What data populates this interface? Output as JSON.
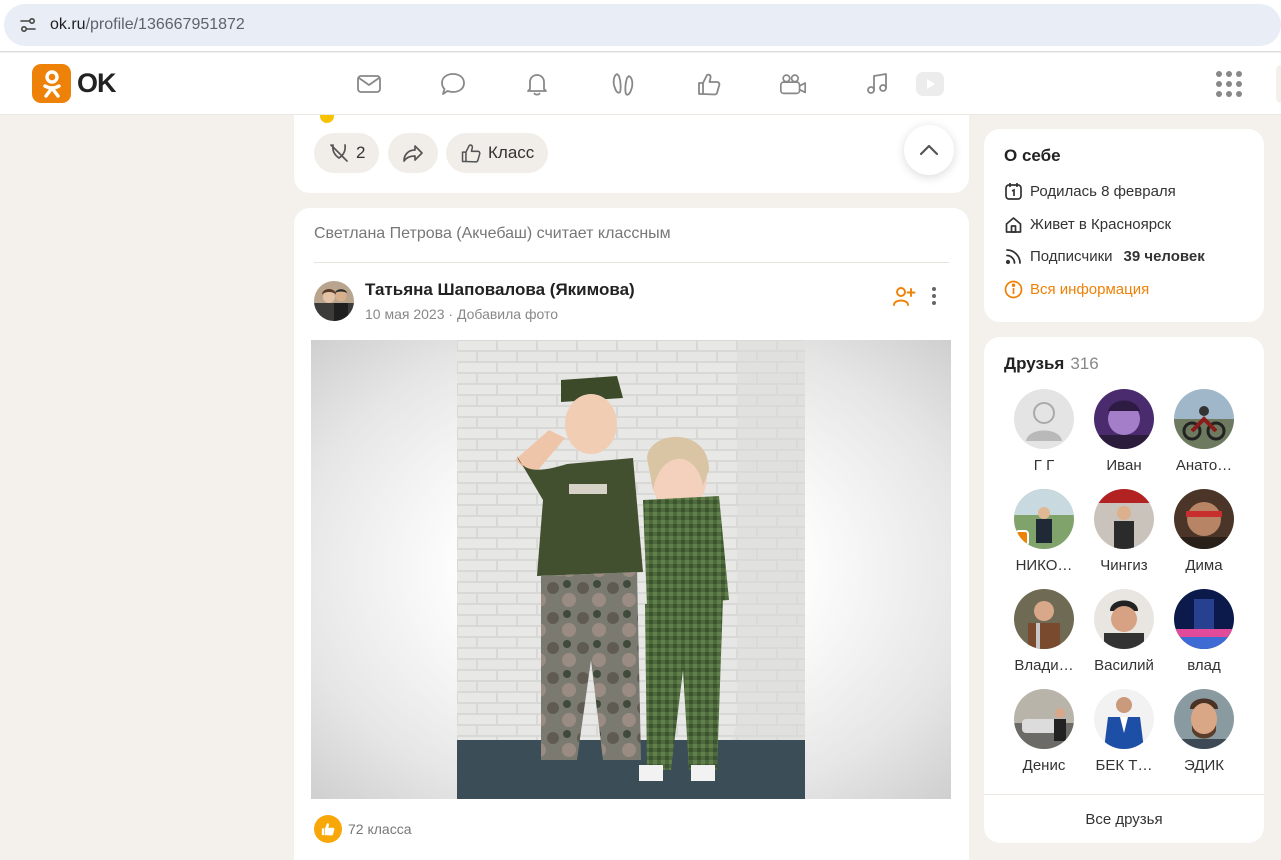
{
  "browser": {
    "url_host": "ok.ru",
    "url_path": "/profile/136667951872"
  },
  "header": {
    "logo_text": "OK",
    "nav_icons": [
      "messages-icon",
      "discussions-icon",
      "notifications-icon",
      "guests-icon",
      "events-icon",
      "video-icon",
      "music-icon",
      "video-tv-icon"
    ]
  },
  "prev_post": {
    "reshare_count": "2",
    "like_label": "Класс"
  },
  "post": {
    "liked_by": "Светлана Петрова (Акчебаш) считает классным",
    "author": "Татьяна Шаповалова (Якимова)",
    "date": "10 мая 2023",
    "separator": "·",
    "action": "Добавила фото",
    "likes": "72 класса"
  },
  "about": {
    "title": "О себе",
    "born": "Родилась 8 февраля",
    "lives": "Живет в Красноярск",
    "followers_prefix": "Подписчики",
    "followers_count": "39 человек",
    "all_info": "Вся информация"
  },
  "friends": {
    "title": "Друзья",
    "count": "316",
    "items": [
      {
        "name": "Г Г"
      },
      {
        "name": "Иван"
      },
      {
        "name": "Анато…"
      },
      {
        "name": "НИКО…"
      },
      {
        "name": "Чингиз"
      },
      {
        "name": "Дима"
      },
      {
        "name": "Влади…"
      },
      {
        "name": "Василий"
      },
      {
        "name": "влад"
      },
      {
        "name": "Денис"
      },
      {
        "name": "БЕК Т…"
      },
      {
        "name": "ЭДИК"
      }
    ],
    "all_label": "Все друзья"
  },
  "colors": {
    "accent": "#ee8208",
    "like_yellow": "#f7a707",
    "background": "#f4f1ed"
  }
}
